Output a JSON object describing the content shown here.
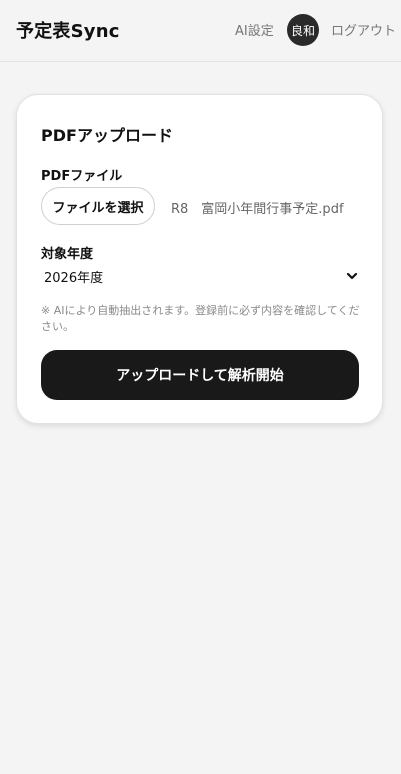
{
  "header": {
    "app_title": "予定表Sync",
    "ai_settings_label": "AI設定",
    "avatar_text": "良和",
    "logout_label": "ログアウト"
  },
  "upload_card": {
    "title": "PDFアップロード",
    "file_label": "PDFファイル",
    "file_button_label": "ファイルを選択",
    "selected_file_name": "R8　富岡小年間行事予定.pdf",
    "year_label": "対象年度",
    "year_value": "2026年度",
    "notice": "※ AIにより自動抽出されます。登録前に必ず内容を確認してください。",
    "submit_label": "アップロードして解析開始"
  },
  "icons": {
    "year_select_chevron": "chevron-down-icon"
  },
  "colors": {
    "page_background": "#f4f4f4",
    "card_background": "#ffffff",
    "primary_button": "#191919",
    "avatar_background": "#2a2a2a",
    "muted_text": "#777777"
  }
}
